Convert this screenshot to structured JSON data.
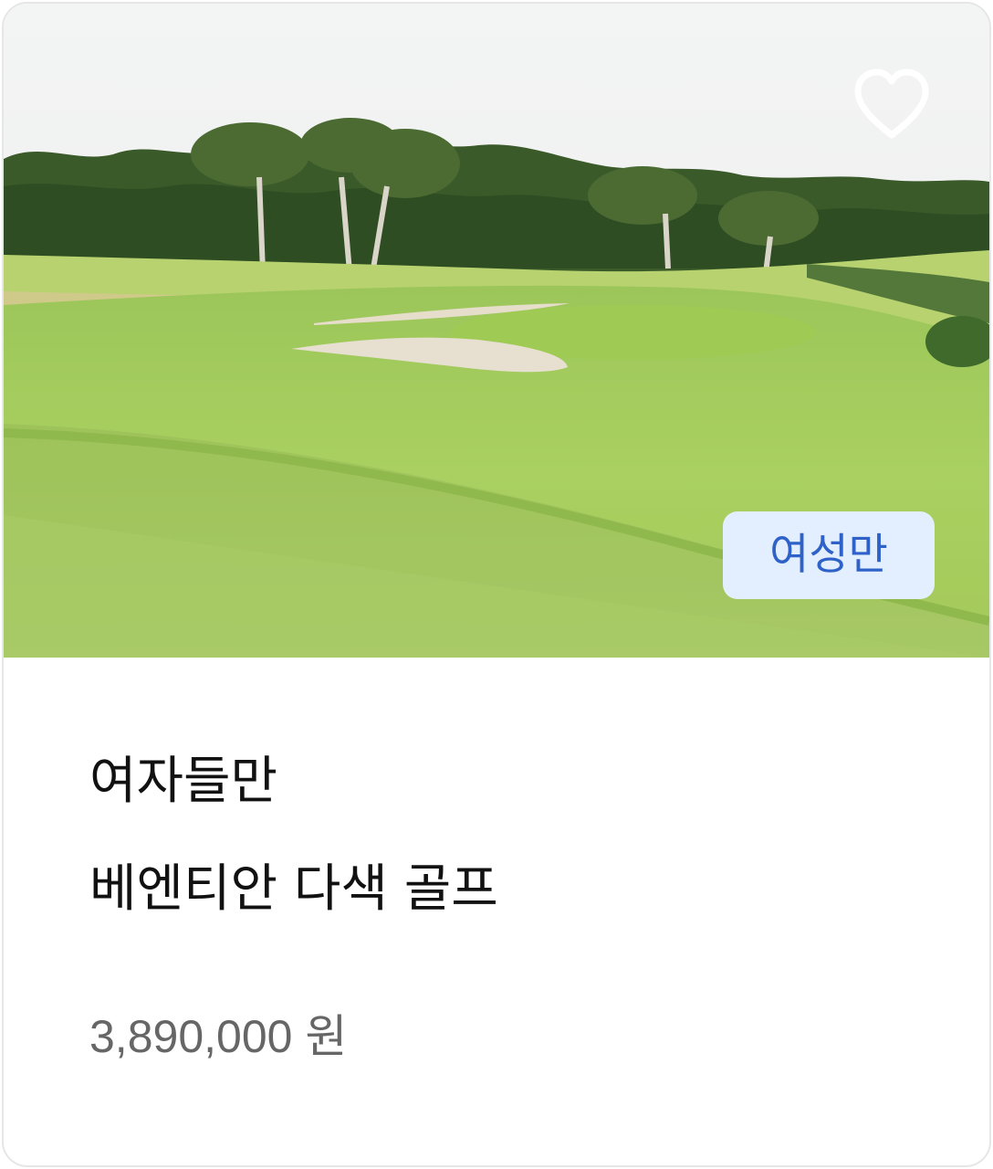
{
  "product": {
    "badge_label": "여성만",
    "title_line1": "여자들만",
    "title_line2": "베엔티안 다색 골프",
    "price": "3,890,000 원",
    "image_subject": "golf-course-photo",
    "favorite_icon": "heart-outline-icon"
  },
  "colors": {
    "badge_bg": "#e3efff",
    "badge_text": "#2f62c9",
    "title_text": "#111111",
    "price_text": "#666666",
    "card_border": "#e6e6e6"
  }
}
